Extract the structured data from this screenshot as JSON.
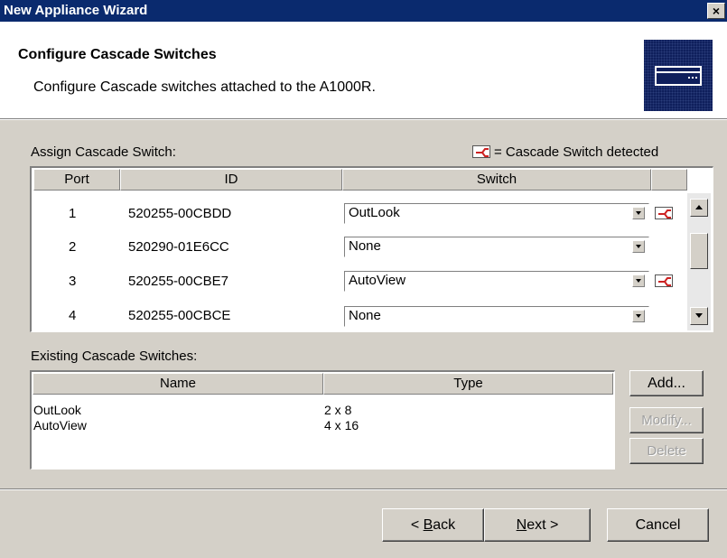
{
  "window": {
    "title": "New Appliance Wizard",
    "close_label": "×"
  },
  "header": {
    "title": "Configure Cascade Switches",
    "subtitle": "Configure Cascade switches attached to the A1000R.",
    "logo_icon": "appliance-icon"
  },
  "assign": {
    "label": "Assign Cascade Switch:",
    "legend_text": "= Cascade Switch detected",
    "legend_icon": "cascade-switch-icon",
    "columns": [
      "Port",
      "ID",
      "Switch"
    ],
    "rows": [
      {
        "port": "1",
        "id": "520255-00CBDD",
        "switch": "OutLook",
        "detected": true
      },
      {
        "port": "2",
        "id": "520290-01E6CC",
        "switch": "None",
        "detected": false
      },
      {
        "port": "3",
        "id": "520255-00CBE7",
        "switch": "AutoView",
        "detected": true
      },
      {
        "port": "4",
        "id": "520255-00CBCE",
        "switch": "None",
        "detected": false
      }
    ]
  },
  "existing": {
    "label": "Existing Cascade Switches:",
    "columns": [
      "Name",
      "Type"
    ],
    "rows": [
      {
        "name": "OutLook",
        "type": "2 x 8"
      },
      {
        "name": "AutoView",
        "type": "4 x 16"
      }
    ],
    "buttons": {
      "add": "Add...",
      "modify": "Modify...",
      "delete": "Delete"
    }
  },
  "footer": {
    "back_prefix": "< ",
    "back_mnemonic": "B",
    "back_rest": "ack",
    "next_mnemonic": "N",
    "next_rest": "ext >",
    "cancel": "Cancel"
  },
  "colors": {
    "titlebar": "#0a2a6e",
    "face": "#d4d0c8",
    "icon_red": "#cc2222"
  }
}
